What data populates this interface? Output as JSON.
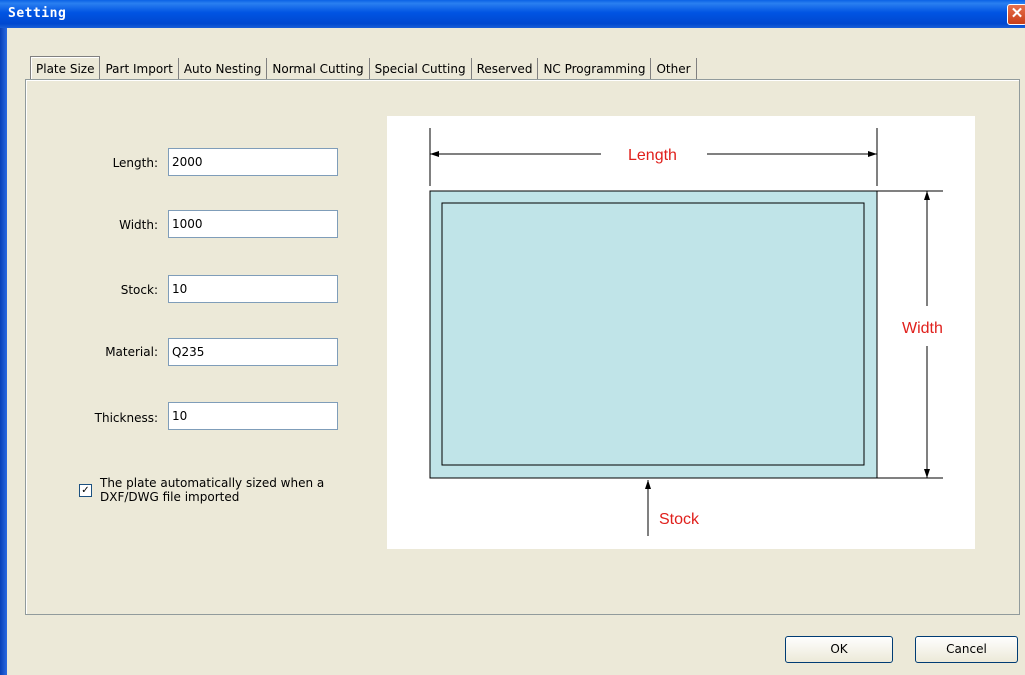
{
  "window": {
    "title": "Setting",
    "close_glyph": "✕"
  },
  "tabs": [
    {
      "label": "Plate Size"
    },
    {
      "label": "Part Import"
    },
    {
      "label": "Auto Nesting"
    },
    {
      "label": "Normal Cutting"
    },
    {
      "label": "Special Cutting"
    },
    {
      "label": "Reserved"
    },
    {
      "label": "NC Programming"
    },
    {
      "label": "Other"
    }
  ],
  "fields": {
    "length": {
      "label": "Length:",
      "value": "2000"
    },
    "width": {
      "label": "Width:",
      "value": "1000"
    },
    "stock": {
      "label": "Stock:",
      "value": "10"
    },
    "material": {
      "label": "Material:",
      "value": "Q235"
    },
    "thickness": {
      "label": "Thickness:",
      "value": "10"
    }
  },
  "auto_size": {
    "checked": true,
    "check_glyph": "✓",
    "label_line1": "The plate automatically sized when a",
    "label_line2": "DXF/DWG file imported"
  },
  "diagram": {
    "length_label": "Length",
    "width_label": "Width",
    "stock_label": "Stock",
    "plate_color": "#c0e4e8",
    "label_color": "#e0201c"
  },
  "buttons": {
    "ok": "OK",
    "cancel": "Cancel"
  }
}
